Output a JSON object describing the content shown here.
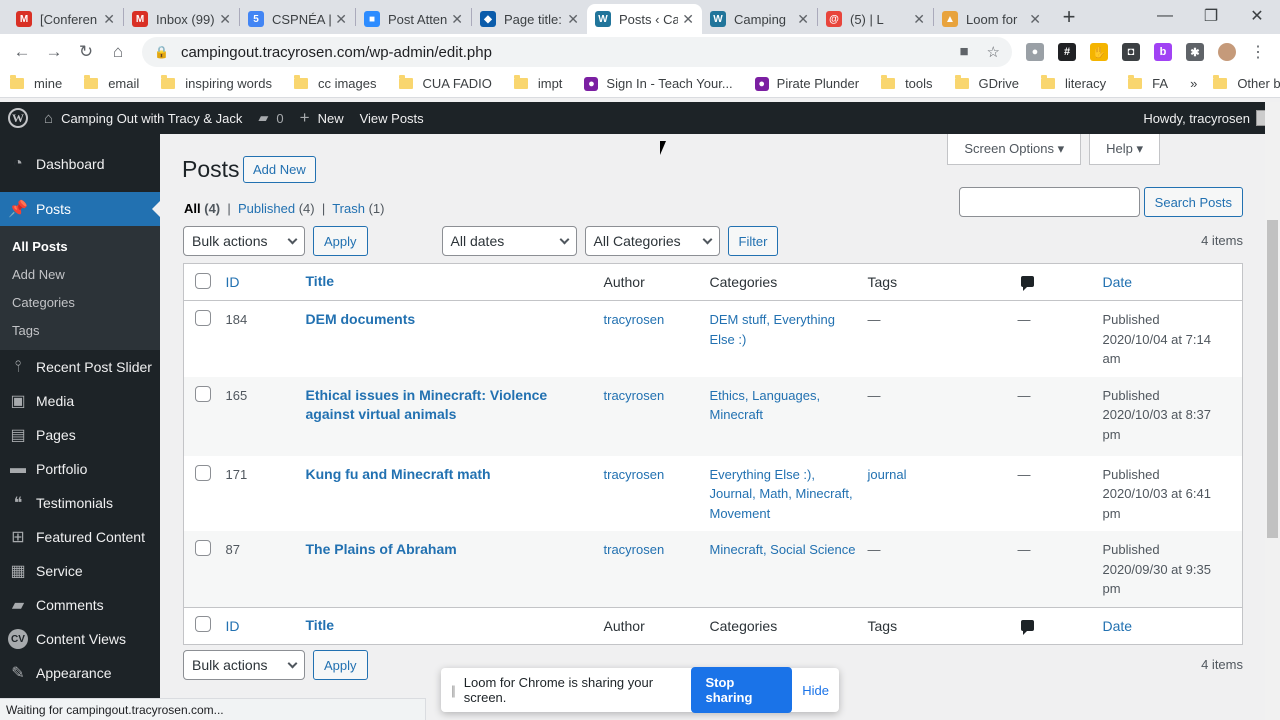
{
  "browser": {
    "tabs": [
      {
        "label": "[Conferen",
        "icon": "gmail-icon",
        "color": "#d93025",
        "glyph": "M"
      },
      {
        "label": "Inbox (99)",
        "icon": "gmail-icon",
        "color": "#d93025",
        "glyph": "M"
      },
      {
        "label": "CSPNÉA |",
        "icon": "calendar-icon",
        "color": "#4285f4",
        "glyph": "5"
      },
      {
        "label": "Post Atten",
        "icon": "zoom-icon",
        "color": "#2d8cff",
        "glyph": "■"
      },
      {
        "label": "Page title:",
        "icon": "diamond-icon",
        "color": "#0b5cab",
        "glyph": "◆"
      },
      {
        "label": "Posts ‹ Ca",
        "icon": "wordpress-icon",
        "color": "#21759b",
        "glyph": "W"
      },
      {
        "label": "Camping",
        "icon": "wordpress-icon",
        "color": "#21759b",
        "glyph": "W"
      },
      {
        "label": "(5) | L",
        "icon": "swirl-icon",
        "color": "#e8453c",
        "glyph": "@"
      },
      {
        "label": "Loom for",
        "icon": "loom-icon",
        "color": "#e8a33d",
        "glyph": "▲"
      }
    ],
    "active_tab": 5,
    "url": "campingout.tracyrosen.com/wp-admin/edit.php",
    "bookmarks": [
      {
        "label": "mine",
        "type": "folder"
      },
      {
        "label": "email",
        "type": "folder"
      },
      {
        "label": "inspiring words",
        "type": "folder"
      },
      {
        "label": "cc images",
        "type": "folder"
      },
      {
        "label": "CUA FADIO",
        "type": "folder"
      },
      {
        "label": "impt",
        "type": "folder"
      },
      {
        "label": "Sign In - Teach Your...",
        "type": "link"
      },
      {
        "label": "Pirate Plunder",
        "type": "link"
      },
      {
        "label": "tools",
        "type": "folder"
      },
      {
        "label": "GDrive",
        "type": "folder"
      },
      {
        "label": "literacy",
        "type": "folder"
      },
      {
        "label": "FA",
        "type": "folder"
      }
    ],
    "more_bookmarks": "»",
    "other_bookmarks": "Other bookmarks",
    "status_text": "Waiting for campingout.tracyrosen.com..."
  },
  "adminbar": {
    "site_name": "Camping Out with Tracy & Jack",
    "comments_count": "0",
    "new_label": "New",
    "view_posts": "View Posts",
    "howdy": "Howdy, tracyrosen"
  },
  "sidebar": {
    "items": [
      {
        "label": "Dashboard",
        "icon": "dashboard-icon",
        "glyph": "◔"
      },
      {
        "label": "Posts",
        "icon": "pin-icon",
        "glyph": "📌",
        "current": true
      },
      {
        "label": "Recent Post Slider",
        "icon": "pin-icon",
        "glyph": "⫯"
      },
      {
        "label": "Media",
        "icon": "media-icon",
        "glyph": "▣"
      },
      {
        "label": "Pages",
        "icon": "pages-icon",
        "glyph": "▤"
      },
      {
        "label": "Portfolio",
        "icon": "portfolio-icon",
        "glyph": "▬"
      },
      {
        "label": "Testimonials",
        "icon": "testimonials-icon",
        "glyph": "❝"
      },
      {
        "label": "Featured Content",
        "icon": "grid-icon",
        "glyph": "⊞"
      },
      {
        "label": "Service",
        "icon": "service-icon",
        "glyph": "▦"
      },
      {
        "label": "Comments",
        "icon": "comment-icon",
        "glyph": "▰"
      },
      {
        "label": "Content Views",
        "icon": "cv-icon",
        "glyph": "CV"
      },
      {
        "label": "Appearance",
        "icon": "brush-icon",
        "glyph": "✎"
      }
    ],
    "submenu": [
      "All Posts",
      "Add New",
      "Categories",
      "Tags"
    ]
  },
  "main": {
    "screen_options": "Screen Options",
    "help": "Help",
    "title": "Posts",
    "add_new": "Add New",
    "filters": {
      "all": "All",
      "all_count": "(4)",
      "published": "Published",
      "published_count": "(4)",
      "trash": "Trash",
      "trash_count": "(1)"
    },
    "search_button": "Search Posts",
    "bulk_actions": "Bulk actions",
    "apply": "Apply",
    "all_dates": "All dates",
    "all_categories": "All Categories",
    "filter": "Filter",
    "items_count": "4 items",
    "columns": {
      "id": "ID",
      "title": "Title",
      "author": "Author",
      "categories": "Categories",
      "tags": "Tags",
      "date": "Date"
    },
    "rows": [
      {
        "id": "184",
        "title": "DEM documents",
        "author": "tracyrosen",
        "categories": "DEM stuff, Everything Else :)",
        "tags": "—",
        "comments": "—",
        "status": "Published",
        "date": "2020/10/04 at 7:14 am"
      },
      {
        "id": "165",
        "title": "Ethical issues in Minecraft: Violence against virtual animals",
        "author": "tracyrosen",
        "categories": "Ethics, Languages, Minecraft",
        "tags": "—",
        "comments": "—",
        "status": "Published",
        "date": "2020/10/03 at 8:37 pm"
      },
      {
        "id": "171",
        "title": "Kung fu and Minecraft math",
        "author": "tracyrosen",
        "categories": "Everything Else :), Journal, Math, Minecraft, Movement",
        "tags": "journal",
        "comments": "—",
        "status": "Published",
        "date": "2020/10/03 at 6:41 pm"
      },
      {
        "id": "87",
        "title": "The Plains of Abraham",
        "author": "tracyrosen",
        "categories": "Minecraft, Social Science",
        "tags": "—",
        "comments": "—",
        "status": "Published",
        "date": "2020/09/30 at 9:35 pm"
      }
    ]
  },
  "loom": {
    "message": "Loom for Chrome is sharing your screen.",
    "stop": "Stop sharing",
    "hide": "Hide"
  }
}
